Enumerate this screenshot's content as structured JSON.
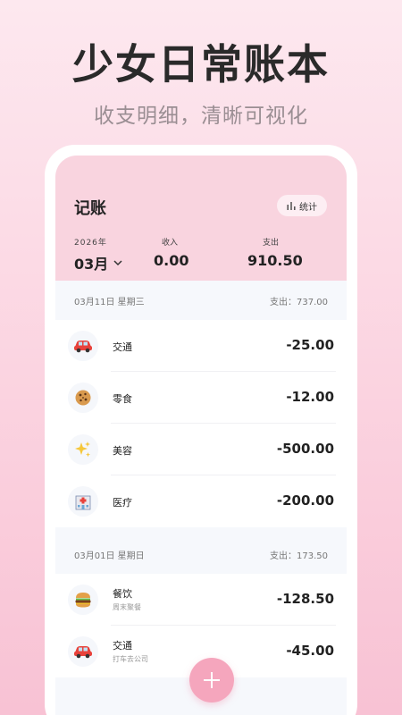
{
  "promo": {
    "title": "少女日常账本",
    "subtitle": "收支明细，清晰可视化"
  },
  "header": {
    "title": "记账",
    "stats_label": "统计",
    "year_label": "2026年",
    "month_value": "03月",
    "income_label": "收入",
    "income_value": "0.00",
    "expense_label": "支出",
    "expense_value": "910.50"
  },
  "days": [
    {
      "date": "03月11日 星期三",
      "total": "支出：737.00",
      "items": [
        {
          "icon": "car-icon",
          "name": "交通",
          "note": "",
          "amount": "-25.00"
        },
        {
          "icon": "cookie-icon",
          "name": "零食",
          "note": "",
          "amount": "-12.00"
        },
        {
          "icon": "sparkles-icon",
          "name": "美容",
          "note": "",
          "amount": "-500.00"
        },
        {
          "icon": "hospital-icon",
          "name": "医疗",
          "note": "",
          "amount": "-200.00"
        }
      ]
    },
    {
      "date": "03月01日 星期日",
      "total": "支出：173.50",
      "items": [
        {
          "icon": "burger-icon",
          "name": "餐饮",
          "note": "周末聚餐",
          "amount": "-128.50"
        },
        {
          "icon": "car-icon",
          "name": "交通",
          "note": "打车去公司",
          "amount": "-45.00"
        }
      ]
    }
  ],
  "colors": {
    "header_bg": "#f9d4df",
    "fab": "#f5a6bd",
    "background_top": "#fde8ef",
    "background_bottom": "#f8c2d4"
  }
}
